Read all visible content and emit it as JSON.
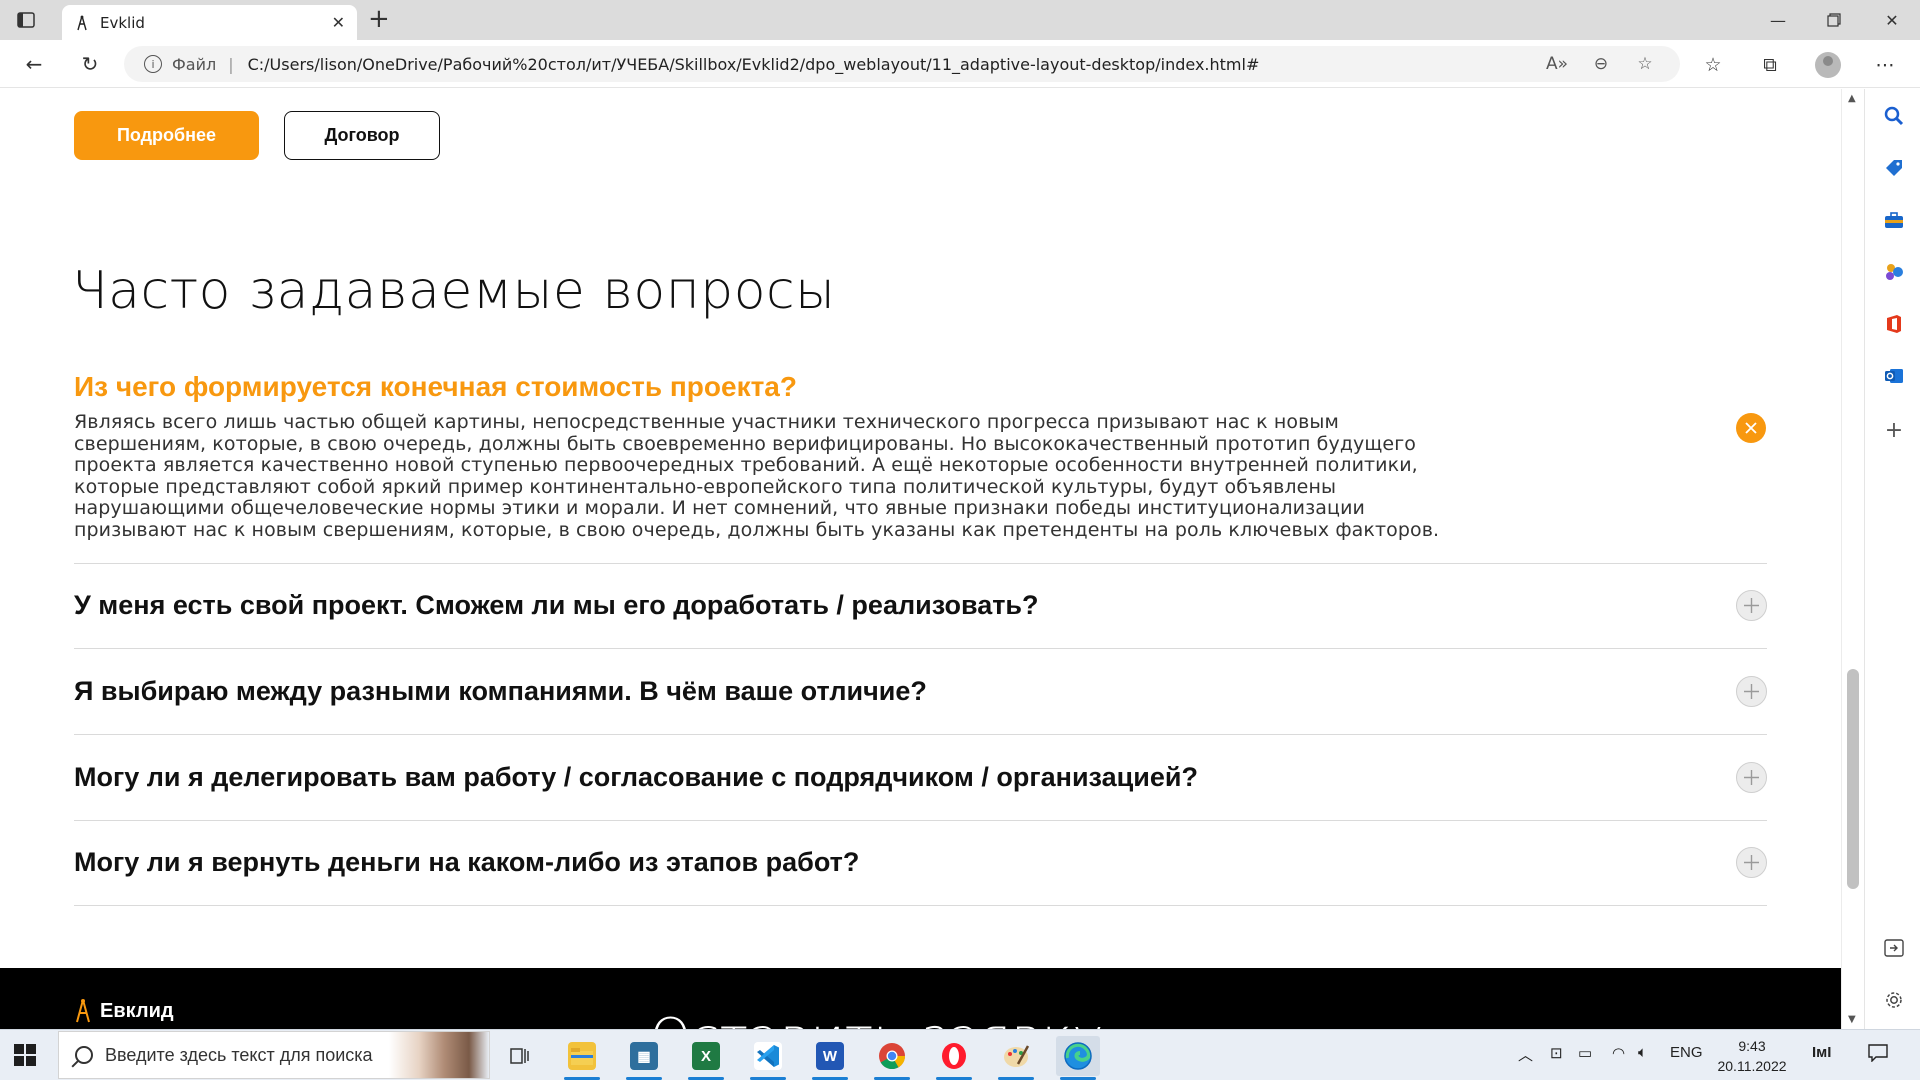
{
  "browser": {
    "tab_title": "Evklid",
    "address": {
      "scheme_label": "Файл",
      "separator": "|",
      "url": "C:/Users/lison/OneDrive/Рабочий%20стол/ит/УЧЕБА/Skillbox/Evklid2/dpo_weblayout/11_adaptive-layout-desktop/index.html#"
    }
  },
  "page": {
    "buttons": {
      "more": "Подробнее",
      "contract": "Договор"
    },
    "faq": {
      "title": "Часто задаваемые вопросы",
      "open_question": "Из чего формируется конечная стоимость проекта?",
      "open_answer_lines": [
        "Являясь всего лишь частью общей картины, непосредственные участники технического прогресса призывают нас к новым",
        "свершениям, которые, в свою очередь, должны быть своевременно верифицированы. Но высококачественный прототип будущего",
        "проекта является качественно новой ступенью первоочередных требований. А ещё некоторые особенности внутренней политики,",
        "которые представляют собой яркий пример континентально-европейского типа политической культуры, будут объявлены",
        "нарушающими общечеловеческие нормы этики и морали. И нет сомнений, что явные признаки победы институционализации",
        "призывают нас к новым свершениям, которые, в свою очередь, должны быть указаны как претенденты на роль ключевых факторов."
      ],
      "items": [
        "У меня есть свой проект. Сможем ли мы его доработать / реализовать?",
        "Я выбираю между разными компаниями. В чём ваше отличие?",
        "Могу ли я делегировать вам работу / согласование с подрядчиком / организацией?",
        "Могу ли я вернуть деньги на каком-либо из этапов работ?"
      ]
    },
    "footer": {
      "logo_text": "Евклид",
      "cta_partial": "Оставить заявку"
    }
  },
  "taskbar": {
    "search_placeholder": "Введите здесь текст для поиска",
    "language": "ENG",
    "time": "9:43",
    "date": "20.11.2022"
  },
  "colors": {
    "accent": "#f8980f",
    "text": "#111111"
  }
}
